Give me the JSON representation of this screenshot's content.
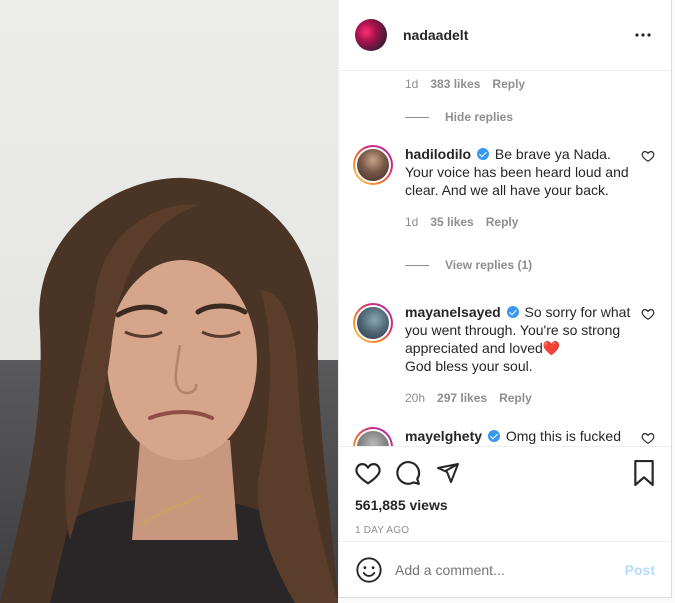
{
  "post": {
    "username": "nadaadelt",
    "views": "561,885 views",
    "timestamp": "1 DAY AGO"
  },
  "top_meta": {
    "time": "1d",
    "likes": "383 likes",
    "reply": "Reply"
  },
  "hide_replies": "Hide replies",
  "comments": [
    {
      "username": "hadilodilo",
      "verified": true,
      "text": "Be brave ya Nada. Your voice has been heard loud and clear. And we all have your back.",
      "time": "1d",
      "likes": "35 likes",
      "reply": "Reply",
      "view_replies": "View replies (1)"
    },
    {
      "username": "mayanelsayed",
      "verified": true,
      "text": "So sorry for what you went through. You're so strong appreciated and loved",
      "emoji": "❤️",
      "text2": "God bless your soul.",
      "time": "20h",
      "likes": "297 likes",
      "reply": "Reply"
    },
    {
      "username": "mayelghety",
      "verified": true,
      "text": "Omg this is fucked"
    }
  ],
  "add_comment": {
    "placeholder": "Add a comment...",
    "post_label": "Post"
  },
  "icons": [
    "more-icon",
    "heart-icon",
    "comment-icon",
    "share-icon",
    "bookmark-icon",
    "emoji-icon"
  ],
  "colors": {
    "link_disabled": "#b3dbff",
    "verified": "#3897f0",
    "muted": "#8e8e8e"
  }
}
